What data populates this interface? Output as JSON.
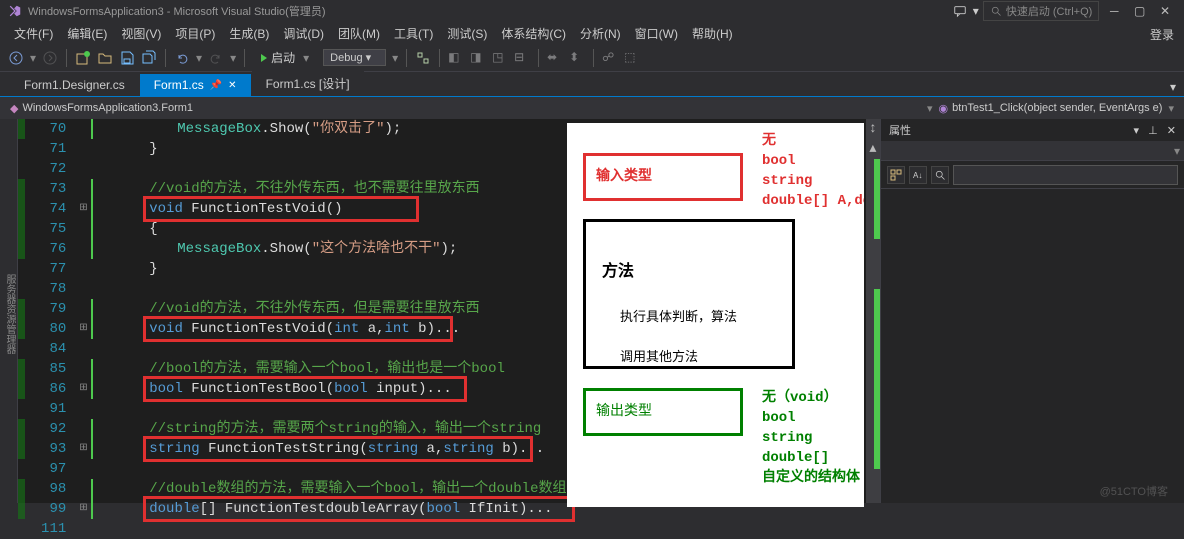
{
  "titlebar": {
    "title": "WindowsFormsApplication3 - Microsoft Visual Studio(管理员)",
    "quick_launch": "快速启动 (Ctrl+Q)"
  },
  "login": "登录",
  "menus": [
    "文件(F)",
    "编辑(E)",
    "视图(V)",
    "项目(P)",
    "生成(B)",
    "调试(D)",
    "团队(M)",
    "工具(T)",
    "测试(S)",
    "体系结构(C)",
    "分析(N)",
    "窗口(W)",
    "帮助(H)"
  ],
  "toolbar": {
    "start_label": "启动",
    "config": "Debug"
  },
  "tabs": [
    {
      "label": "Form1.Designer.cs"
    },
    {
      "label": "Form1.cs"
    },
    {
      "label": "Form1.cs [设计]"
    }
  ],
  "crumb": {
    "left": "WindowsFormsApplication3.Form1",
    "right": "btnTest1_Click(object sender, EventArgs e)"
  },
  "code_lines": [
    {
      "n": 70,
      "f": "",
      "g": "cb-g",
      "html": "<span class='typ'>MessageBox</span><span class='pun'>.</span><span class='id'>Show</span><span class='pun'>(</span><span class='str'>\"你双击了\"</span><span class='pun'>);</span>",
      "indent": 3
    },
    {
      "n": 71,
      "f": "",
      "g": "",
      "html": "<span class='pun'>}</span>",
      "indent": 2
    },
    {
      "n": 72,
      "f": "",
      "g": "",
      "html": "",
      "indent": 0
    },
    {
      "n": 73,
      "f": "",
      "g": "cb-g",
      "html": "<span class='com'>//void的方法，不往外传东西，也不需要往里放东西</span>",
      "indent": 2
    },
    {
      "n": 74,
      "f": "+",
      "g": "cb-g",
      "html": "<span class='kw'>void</span> <span class='id'>FunctionTestVoid</span><span class='pun'>()</span>",
      "indent": 2,
      "rbox": [
        0,
        276,
        26
      ]
    },
    {
      "n": 75,
      "f": "",
      "g": "cb-g",
      "html": "<span class='pun'>{</span>",
      "indent": 2
    },
    {
      "n": 76,
      "f": "",
      "g": "cb-g",
      "html": "<span class='typ'>MessageBox</span><span class='pun'>.</span><span class='id'>Show</span><span class='pun'>(</span><span class='str'>\"这个方法啥也不干\"</span><span class='pun'>);</span>",
      "indent": 3
    },
    {
      "n": 77,
      "f": "",
      "g": "",
      "html": "<span class='pun'>}</span>",
      "indent": 2
    },
    {
      "n": 78,
      "f": "",
      "g": "",
      "html": "",
      "indent": 0
    },
    {
      "n": 79,
      "f": "",
      "g": "cb-g",
      "html": "<span class='com'>//void的方法，不往外传东西，但是需要往里放东西</span>",
      "indent": 2
    },
    {
      "n": 80,
      "f": "+",
      "g": "cb-g",
      "html": "<span class='kw'>void</span> <span class='id'>FunctionTestVoid</span><span class='pun'>(</span><span class='kw'>int</span> <span class='id'>a</span><span class='pun'>,</span><span class='kw'>int</span> <span class='id'>b</span><span class='pun'>)</span><span class='pun'>...</span>",
      "indent": 2,
      "rbox": [
        0,
        310,
        26
      ]
    },
    {
      "n": 84,
      "f": "",
      "g": "",
      "html": "",
      "indent": 0
    },
    {
      "n": 85,
      "f": "",
      "g": "cb-g",
      "html": "<span class='com'>//bool的方法，需要输入一个bool，输出也是一个bool</span>",
      "indent": 2
    },
    {
      "n": 86,
      "f": "+",
      "g": "cb-g",
      "html": "<span class='kw'>bool</span> <span class='id'>FunctionTestBool</span><span class='pun'>(</span><span class='kw'>bool</span> <span class='id'>input</span><span class='pun'>)</span><span class='pun'>...</span>",
      "indent": 2,
      "rbox": [
        0,
        324,
        26
      ]
    },
    {
      "n": 91,
      "f": "",
      "g": "",
      "html": "",
      "indent": 0
    },
    {
      "n": 92,
      "f": "",
      "g": "cb-g",
      "html": "<span class='com'>//string的方法，需要两个string的输入，输出一个string</span>",
      "indent": 2
    },
    {
      "n": 93,
      "f": "+",
      "g": "cb-g",
      "html": "<span class='kw'>string</span> <span class='id'>FunctionTestString</span><span class='pun'>(</span><span class='kw'>string</span> <span class='id'>a</span><span class='pun'>,</span><span class='kw'>string</span> <span class='id'>b</span><span class='pun'>)</span><span class='pun'>...</span>",
      "indent": 2,
      "rbox": [
        0,
        390,
        26
      ]
    },
    {
      "n": 97,
      "f": "",
      "g": "",
      "html": "",
      "indent": 0
    },
    {
      "n": 98,
      "f": "",
      "g": "cb-g",
      "html": "<span class='com'>//double数组的方法，需要输入一个bool，输出一个double数组</span>",
      "indent": 2
    },
    {
      "n": 99,
      "f": "+",
      "g": "cb-g",
      "html": "<span class='kw'>double</span><span class='pun'>[]</span> <span class='id'>FunctionTestdoubleArray</span><span class='pun'>(</span><span class='kw'>bool</span> <span class='id'>IfInit</span><span class='pun'>)</span><span class='pun'>...</span>",
      "indent": 2,
      "rbox": [
        0,
        432,
        26
      ]
    },
    {
      "n": 111,
      "f": "",
      "g": "",
      "html": "",
      "indent": 0
    }
  ],
  "diagram": {
    "input_label": "输入类型",
    "input_items": "无\nbool\nstring\ndouble[] A,double[]B",
    "method_title": "方法",
    "method_line1": "执行具体判断，算法",
    "method_line2": "调用其他方法",
    "output_label": "输出类型",
    "output_items": "无（void）\nbool\nstring\ndouble[]\n自定义的结构体"
  },
  "props": {
    "title": "属性"
  },
  "sidebar_left": "服务器资源管理器",
  "watermark": "@51CTO博客"
}
